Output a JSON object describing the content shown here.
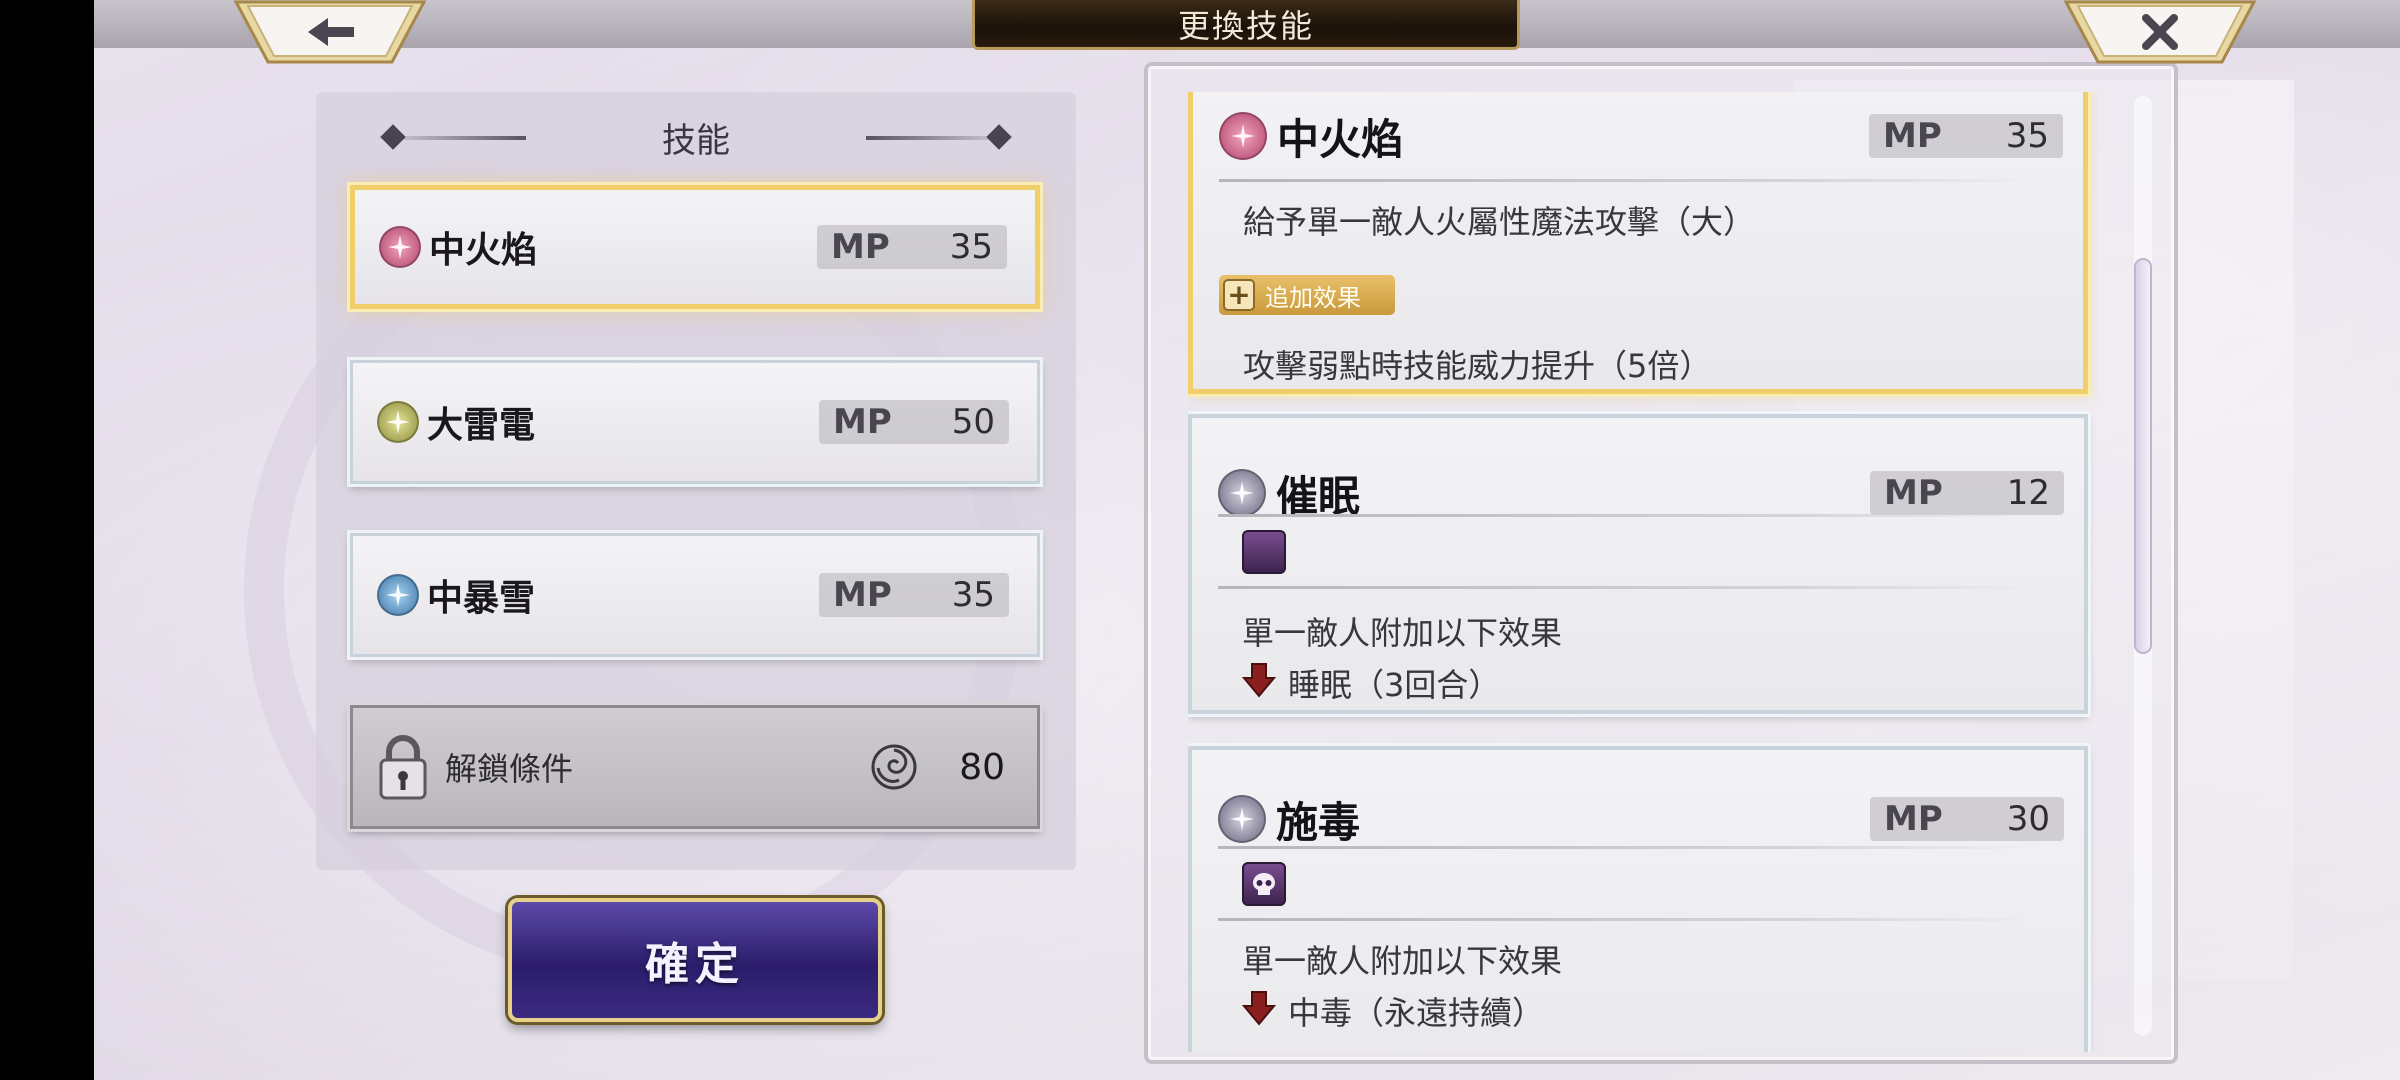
{
  "header": {
    "title": "更換技能"
  },
  "left_panel": {
    "heading": "技能",
    "slots": [
      {
        "name": "中火焰",
        "mp_label": "MP",
        "mp": "35",
        "element": "fire-icon",
        "selected": true
      },
      {
        "name": "大雷電",
        "mp_label": "MP",
        "mp": "50",
        "element": "thunder-icon",
        "selected": false
      },
      {
        "name": "中暴雪",
        "mp_label": "MP",
        "mp": "35",
        "element": "ice-icon",
        "selected": false
      }
    ],
    "locked_slot": {
      "label": "解鎖條件",
      "value": "80"
    },
    "confirm_label": "確定"
  },
  "detail_cards": [
    {
      "name": "中火焰",
      "mp_label": "MP",
      "mp": "35",
      "description": "給予單一敵人火屬性魔法攻擊（大）",
      "extra_tag": "追加效果",
      "extra_text": "攻擊弱點時技能威力提升（5倍）"
    },
    {
      "name": "催眠",
      "mp_label": "MP",
      "mp": "12",
      "status_icon": "moon-icon",
      "description": "單一敵人附加以下效果",
      "effect": "睡眠（3回合）"
    },
    {
      "name": "施毒",
      "mp_label": "MP",
      "mp": "30",
      "status_icon": "skull-icon",
      "description": "單一敵人附加以下效果",
      "effect": "中毒（永遠持續）"
    }
  ],
  "colors": {
    "selected_border": "#f0cf6a",
    "confirm_button": "#3a2a82",
    "fire": "#b2456e",
    "thunder": "#8c8c3c",
    "ice": "#3f77a8",
    "dark": "#6a6680"
  }
}
